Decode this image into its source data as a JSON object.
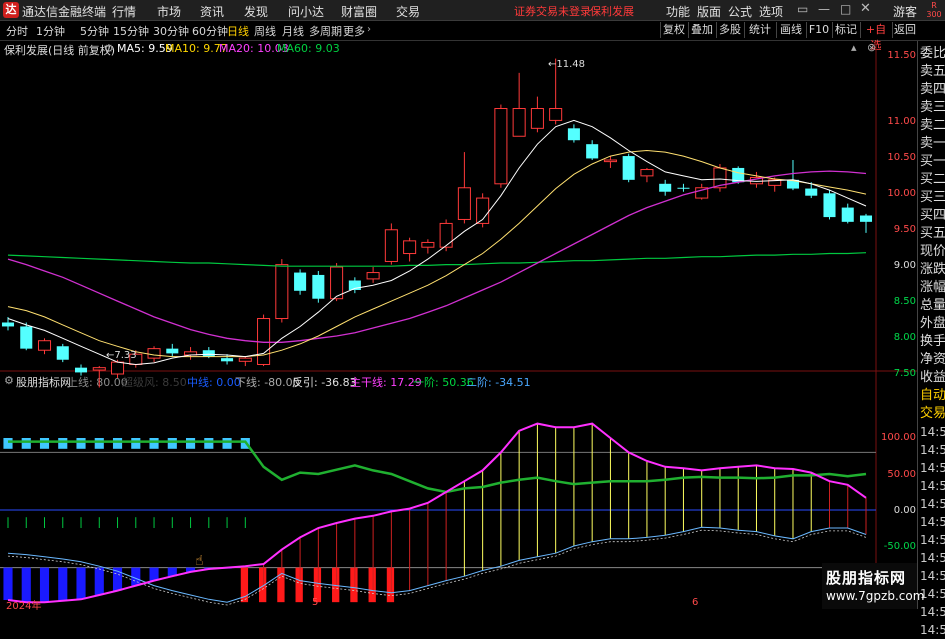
{
  "app": {
    "name": "通达信金融终端",
    "logo_glyph": "达",
    "menu": [
      "行情",
      "市场",
      "资讯",
      "发现",
      "问小达",
      "财富圈",
      "交易"
    ],
    "notice": "证券交易未登录",
    "stock_link": "保利发展",
    "right_menu": [
      "功能",
      "版面",
      "公式",
      "选项"
    ],
    "guest": "游客",
    "window_icons": [
      "chat-icon",
      "min-icon",
      "max-icon",
      "close-icon"
    ],
    "badge": "R 300"
  },
  "periods": [
    "分时",
    "1分钟",
    "5分钟",
    "15分钟",
    "30分钟",
    "60分钟",
    "日线",
    "周线",
    "月线",
    "多周期",
    "更多"
  ],
  "active_period": "日线",
  "right_toolbar": [
    "复权",
    "叠加",
    "多股",
    "统计",
    "画线",
    "F10",
    "标记",
    "+自选",
    "返回"
  ],
  "main_chart": {
    "title": "保利发展(日线 前复权)",
    "ma": [
      {
        "name": "MA5",
        "value": "9.59",
        "color": "#ffffff"
      },
      {
        "name": "MA10",
        "value": "9.77",
        "color": "#ffd700"
      },
      {
        "name": "MA20",
        "value": "10.03",
        "color": "#ff40ff"
      },
      {
        "name": "MA60",
        "value": "9.03",
        "color": "#00d040"
      }
    ],
    "high_label": "11.48",
    "low_label": "7.33",
    "y_axis": [
      "11.50",
      "11.00",
      "10.50",
      "10.00",
      "9.50",
      "9.00",
      "8.50",
      "8.00",
      "7.50"
    ]
  },
  "sub_chart": {
    "title": "股朋指标网",
    "labels": [
      {
        "text": "上线: 80.00",
        "color": "#8a8a8a"
      },
      {
        "text": "超级风: 8.50",
        "color": "#3a3a3a"
      },
      {
        "text": "中线: 0.00",
        "color": "#1a5cff"
      },
      {
        "text": "下线: -80.00",
        "color": "#aaaaaa"
      },
      {
        "text": "反引: -36.83",
        "color": "#e0e0e0"
      },
      {
        "text": "主干线: 17.29",
        "color": "#ff40ff"
      },
      {
        "text": "一阶: 50.36",
        "color": "#00d840"
      },
      {
        "text": "二阶: -34.51",
        "color": "#4aa8ff"
      }
    ],
    "y_axis": [
      "100.00",
      "50.00",
      "0.00",
      "-50.00"
    ]
  },
  "x_axis": [
    "2024年",
    "5",
    "6"
  ],
  "right_panel": {
    "quote_items": [
      "委比",
      "卖五",
      "卖四",
      "卖三",
      "卖二",
      "卖一",
      "买一",
      "买二",
      "买三",
      "买四",
      "买五",
      "现价",
      "涨跌",
      "涨幅",
      "总量",
      "外盘",
      "换手",
      "净资",
      "收益"
    ],
    "auto_trade": [
      "自动",
      "交易"
    ],
    "times": [
      "14:56",
      "14:56",
      "14:56",
      "14:56",
      "14:56",
      "14:56",
      "14:56",
      "14:56",
      "14:56",
      "14:56",
      "14:56",
      "14:56"
    ]
  },
  "watermark": {
    "line1": "股朋指标网",
    "line2": "www.7gpzb.com"
  },
  "chart_data": {
    "type": "candlestick",
    "title": "",
    "candles": [
      {
        "o": 8.15,
        "h": 8.22,
        "l": 8.05,
        "c": 8.1
      },
      {
        "o": 8.1,
        "h": 8.15,
        "l": 7.8,
        "c": 7.82
      },
      {
        "o": 7.8,
        "h": 7.95,
        "l": 7.75,
        "c": 7.92
      },
      {
        "o": 7.85,
        "h": 7.88,
        "l": 7.65,
        "c": 7.68
      },
      {
        "o": 7.58,
        "h": 7.62,
        "l": 7.48,
        "c": 7.52
      },
      {
        "o": 7.55,
        "h": 7.6,
        "l": 7.33,
        "c": 7.58
      },
      {
        "o": 7.5,
        "h": 7.68,
        "l": 7.45,
        "c": 7.65
      },
      {
        "o": 7.62,
        "h": 7.8,
        "l": 7.58,
        "c": 7.75
      },
      {
        "o": 7.7,
        "h": 7.85,
        "l": 7.65,
        "c": 7.82
      },
      {
        "o": 7.82,
        "h": 7.88,
        "l": 7.72,
        "c": 7.76
      },
      {
        "o": 7.74,
        "h": 7.84,
        "l": 7.68,
        "c": 7.78
      },
      {
        "o": 7.8,
        "h": 7.84,
        "l": 7.7,
        "c": 7.72
      },
      {
        "o": 7.7,
        "h": 7.75,
        "l": 7.62,
        "c": 7.66
      },
      {
        "o": 7.66,
        "h": 7.72,
        "l": 7.6,
        "c": 7.7
      },
      {
        "o": 7.62,
        "h": 8.25,
        "l": 7.6,
        "c": 8.2
      },
      {
        "o": 8.2,
        "h": 8.95,
        "l": 8.15,
        "c": 8.88
      },
      {
        "o": 8.78,
        "h": 8.82,
        "l": 8.5,
        "c": 8.55
      },
      {
        "o": 8.75,
        "h": 8.8,
        "l": 8.4,
        "c": 8.45
      },
      {
        "o": 8.45,
        "h": 8.9,
        "l": 8.42,
        "c": 8.85
      },
      {
        "o": 8.68,
        "h": 8.72,
        "l": 8.52,
        "c": 8.56
      },
      {
        "o": 8.7,
        "h": 8.85,
        "l": 8.65,
        "c": 8.78
      },
      {
        "o": 8.92,
        "h": 9.4,
        "l": 8.88,
        "c": 9.32
      },
      {
        "o": 9.02,
        "h": 9.22,
        "l": 8.92,
        "c": 9.18
      },
      {
        "o": 9.1,
        "h": 9.2,
        "l": 9.02,
        "c": 9.16
      },
      {
        "o": 9.1,
        "h": 9.45,
        "l": 9.05,
        "c": 9.4
      },
      {
        "o": 9.45,
        "h": 10.3,
        "l": 9.4,
        "c": 9.85
      },
      {
        "o": 9.4,
        "h": 9.78,
        "l": 9.35,
        "c": 9.72
      },
      {
        "o": 9.9,
        "h": 10.9,
        "l": 9.85,
        "c": 10.85
      },
      {
        "o": 10.5,
        "h": 11.3,
        "l": 10.7,
        "c": 10.85
      },
      {
        "o": 10.6,
        "h": 11.0,
        "l": 10.55,
        "c": 10.85
      },
      {
        "o": 10.7,
        "h": 11.48,
        "l": 10.65,
        "c": 10.85
      },
      {
        "o": 10.6,
        "h": 10.65,
        "l": 10.42,
        "c": 10.45
      },
      {
        "o": 10.4,
        "h": 10.45,
        "l": 10.2,
        "c": 10.22
      },
      {
        "o": 10.18,
        "h": 10.25,
        "l": 10.1,
        "c": 10.2
      },
      {
        "o": 10.25,
        "h": 10.28,
        "l": 9.92,
        "c": 9.95
      },
      {
        "o": 10.0,
        "h": 10.1,
        "l": 9.92,
        "c": 10.08
      },
      {
        "o": 9.9,
        "h": 9.95,
        "l": 9.75,
        "c": 9.8
      },
      {
        "o": 9.85,
        "h": 9.9,
        "l": 9.8,
        "c": 9.84
      },
      {
        "o": 9.72,
        "h": 9.9,
        "l": 9.7,
        "c": 9.85
      },
      {
        "o": 9.85,
        "h": 10.15,
        "l": 9.8,
        "c": 10.1
      },
      {
        "o": 10.1,
        "h": 10.12,
        "l": 9.9,
        "c": 9.92
      },
      {
        "o": 9.9,
        "h": 10.05,
        "l": 9.85,
        "c": 9.98
      },
      {
        "o": 9.88,
        "h": 9.98,
        "l": 9.8,
        "c": 9.95
      },
      {
        "o": 9.95,
        "h": 10.2,
        "l": 9.82,
        "c": 9.84
      },
      {
        "o": 9.84,
        "h": 9.92,
        "l": 9.72,
        "c": 9.75
      },
      {
        "o": 9.78,
        "h": 9.82,
        "l": 9.45,
        "c": 9.48
      },
      {
        "o": 9.6,
        "h": 9.65,
        "l": 9.4,
        "c": 9.42
      },
      {
        "o": 9.5,
        "h": 9.52,
        "l": 9.28,
        "c": 9.42
      }
    ],
    "ma5": [
      8.2,
      8.12,
      8.05,
      7.95,
      7.85,
      7.75,
      7.65,
      7.62,
      7.64,
      7.7,
      7.74,
      7.75,
      7.74,
      7.72,
      7.76,
      7.95,
      8.1,
      8.28,
      8.48,
      8.58,
      8.62,
      8.68,
      8.8,
      8.95,
      9.12,
      9.3,
      9.45,
      9.75,
      10.1,
      10.4,
      10.62,
      10.7,
      10.62,
      10.48,
      10.32,
      10.18,
      10.05,
      10.0,
      9.95,
      9.96,
      9.94,
      9.93,
      9.94,
      9.95,
      9.9,
      9.82,
      9.72,
      9.62
    ],
    "ma10": [
      8.35,
      8.3,
      8.22,
      8.12,
      8.02,
      7.92,
      7.85,
      7.78,
      7.74,
      7.72,
      7.72,
      7.72,
      7.72,
      7.72,
      7.74,
      7.8,
      7.88,
      7.98,
      8.1,
      8.22,
      8.32,
      8.42,
      8.52,
      8.62,
      8.74,
      8.88,
      9.02,
      9.2,
      9.4,
      9.62,
      9.84,
      10.02,
      10.15,
      10.25,
      10.3,
      10.32,
      10.3,
      10.25,
      10.18,
      10.1,
      10.04,
      10.0,
      9.96,
      9.94,
      9.9,
      9.86,
      9.82,
      9.77
    ],
    "ma20": [
      8.95,
      8.88,
      8.8,
      8.72,
      8.62,
      8.52,
      8.42,
      8.32,
      8.22,
      8.14,
      8.06,
      8.0,
      7.95,
      7.92,
      7.9,
      7.9,
      7.92,
      7.95,
      7.98,
      8.02,
      8.08,
      8.14,
      8.2,
      8.28,
      8.36,
      8.46,
      8.56,
      8.66,
      8.78,
      8.9,
      9.02,
      9.14,
      9.26,
      9.38,
      9.5,
      9.6,
      9.68,
      9.76,
      9.82,
      9.88,
      9.92,
      9.96,
      10.0,
      10.03,
      10.05,
      10.06,
      10.05,
      10.03
    ],
    "ma60": [
      9.0,
      8.99,
      8.98,
      8.97,
      8.96,
      8.95,
      8.94,
      8.93,
      8.92,
      8.91,
      8.9,
      8.9,
      8.89,
      8.88,
      8.87,
      8.86,
      8.86,
      8.86,
      8.86,
      8.86,
      8.86,
      8.86,
      8.87,
      8.87,
      8.88,
      8.88,
      8.89,
      8.9,
      8.9,
      8.91,
      8.92,
      8.93,
      8.93,
      8.94,
      8.95,
      8.96,
      8.96,
      8.97,
      8.98,
      8.98,
      8.99,
      9.0,
      9.0,
      9.01,
      9.01,
      9.02,
      9.02,
      9.03
    ],
    "indicator": {
      "main_line": [
        -125,
        -128,
        -128,
        -126,
        -124,
        -118,
        -112,
        -105,
        -98,
        -92,
        -86,
        -82,
        -80,
        -78,
        -75,
        -55,
        -38,
        -25,
        -18,
        -12,
        -8,
        -2,
        2,
        10,
        25,
        40,
        55,
        80,
        110,
        120,
        115,
        115,
        120,
        100,
        80,
        68,
        60,
        58,
        55,
        58,
        60,
        62,
        58,
        57,
        52,
        40,
        35,
        17
      ],
      "first_order": [
        95,
        95,
        95,
        95,
        95,
        95,
        95,
        95,
        95,
        95,
        95,
        95,
        95,
        95,
        60,
        42,
        52,
        50,
        56,
        62,
        55,
        50,
        40,
        30,
        25,
        30,
        32,
        38,
        42,
        45,
        40,
        36,
        38,
        40,
        40,
        40,
        42,
        45,
        46,
        45,
        45,
        44,
        45,
        48,
        48,
        50,
        47,
        50
      ],
      "second_order": [
        -60,
        -62,
        -65,
        -68,
        -72,
        -78,
        -85,
        -95,
        -105,
        -112,
        -118,
        -124,
        -128,
        -120,
        -105,
        -88,
        -98,
        -102,
        -105,
        -108,
        -112,
        -115,
        -112,
        -105,
        -98,
        -92,
        -84,
        -78,
        -70,
        -65,
        -60,
        -50,
        -44,
        -40,
        -40,
        -38,
        -35,
        -30,
        -24,
        -25,
        -28,
        -30,
        -36,
        -40,
        -30,
        -25,
        -25,
        -34
      ],
      "upper_line": 80,
      "mid_line": 0,
      "lower_line": -80
    }
  }
}
